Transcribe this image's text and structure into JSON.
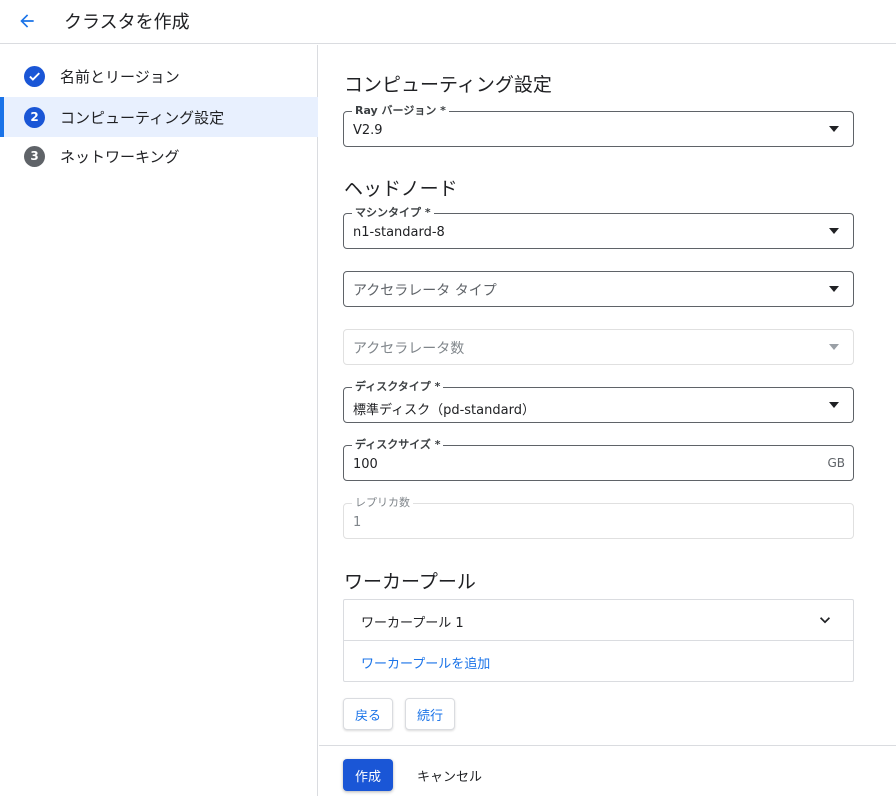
{
  "header": {
    "title": "クラスタを作成",
    "back_icon": "arrow-left-icon"
  },
  "sidebar": {
    "steps": [
      {
        "number": "✓",
        "label": "名前とリージョン",
        "status": "done"
      },
      {
        "number": "2",
        "label": "コンピューティング設定",
        "status": "current"
      },
      {
        "number": "3",
        "label": "ネットワーキング",
        "status": "todo"
      }
    ]
  },
  "main": {
    "compute_title": "コンピューティング設定",
    "ray_version": {
      "label": "Ray バージョン *",
      "value": "V2.9"
    },
    "head_node_title": "ヘッドノード",
    "machine_type": {
      "label": "マシンタイプ *",
      "value": "n1-standard-8"
    },
    "accelerator_type": {
      "placeholder": "アクセラレータ タイプ"
    },
    "accelerator_count": {
      "placeholder": "アクセラレータ数"
    },
    "disk_type": {
      "label": "ディスクタイプ *",
      "value": "標準ディスク（pd-standard）"
    },
    "disk_size": {
      "label": "ディスクサイズ *",
      "value": "100",
      "suffix": "GB"
    },
    "replica_count": {
      "label": "レプリカ数",
      "value": "1"
    },
    "worker_pool_title": "ワーカープール",
    "worker_pool": {
      "name": "ワーカープール 1",
      "add_label": "ワーカープールを追加"
    },
    "back_button": "戻る",
    "continue_button": "続行"
  },
  "footer": {
    "create_button": "作成",
    "cancel_button": "キャンセル"
  },
  "colors": {
    "accent": "#1a73e8",
    "primary_button": "#1a56d6",
    "active_step_bg": "#e8f0fe"
  }
}
